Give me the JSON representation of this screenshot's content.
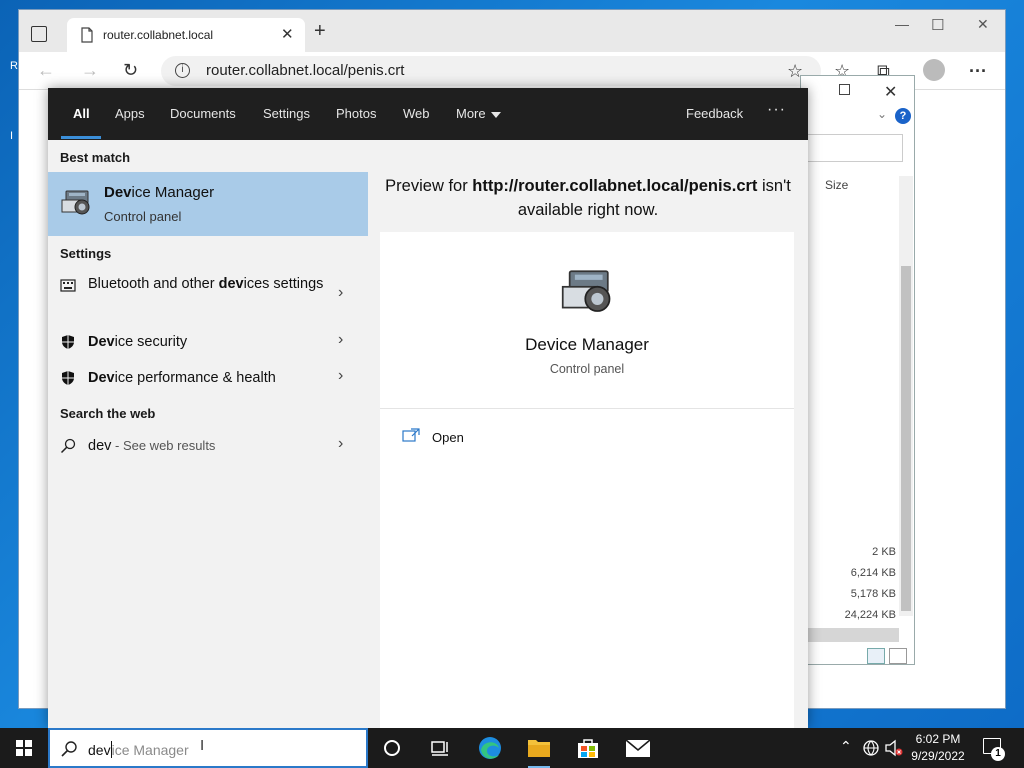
{
  "browser": {
    "tab_title": "router.collabnet.local",
    "address_url": "router.collabnet.local/penis.crt"
  },
  "dialog": {
    "column_size": "Size",
    "sizes": [
      "2 KB",
      "6,214 KB",
      "5,178 KB",
      "24,224 KB"
    ]
  },
  "search": {
    "filters": [
      "All",
      "Apps",
      "Documents",
      "Settings",
      "Photos",
      "Web",
      "More"
    ],
    "feedback": "Feedback",
    "best_match_heading": "Best match",
    "best": {
      "prefix": "Dev",
      "rest": "ice Manager",
      "subtitle": "Control panel"
    },
    "settings_heading": "Settings",
    "settings_items": [
      {
        "pre": "Bluetooth and other ",
        "bold": "dev",
        "post": "ices settings",
        "icon": "keyboard-icon"
      },
      {
        "pre": "",
        "bold": "Dev",
        "post": "ice security",
        "icon": "shield-icon"
      },
      {
        "pre": "",
        "bold": "Dev",
        "post": "ice performance & health",
        "icon": "shield-icon"
      }
    ],
    "web_heading": "Search the web",
    "web_query": "dev",
    "web_hint": " - See web results"
  },
  "preview": {
    "message_prefix": "Preview for ",
    "message_url": "http://router.collabnet.local/penis.crt",
    "message_suffix": " isn't available right now.",
    "title": "Device Manager",
    "subtitle": "Control panel",
    "open_label": "Open"
  },
  "taskbar": {
    "typed": "dev",
    "suggestion": "ice Manager",
    "time": "6:02 PM",
    "date": "9/29/2022",
    "notification_count": "1"
  },
  "colors": {
    "accent": "#3b8fd9",
    "selection": "#a9cbe8",
    "taskbar": "#1b1b1b"
  }
}
